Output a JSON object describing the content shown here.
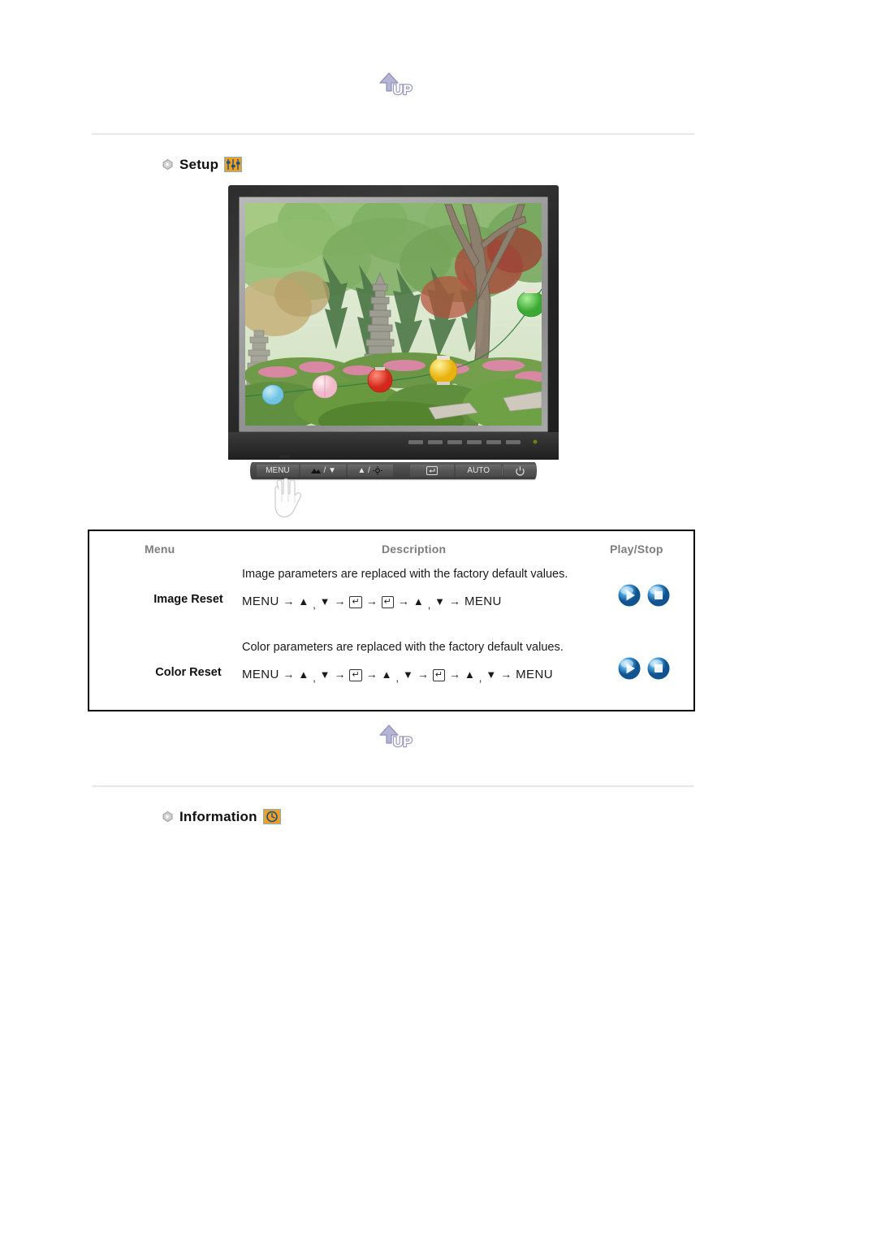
{
  "page": {
    "up_button_label": "UP",
    "up_button_icon": "up-arrow-icon"
  },
  "sections": [
    {
      "id": "setup",
      "title": "Setup",
      "bullet_icon": "diamond-bullet-icon",
      "badge_icon": "sliders-icon",
      "badge_color": "#f0a020"
    },
    {
      "id": "information",
      "title": "Information",
      "bullet_icon": "diamond-bullet-icon",
      "badge_icon": "clock-icon",
      "badge_color": "#f0a020"
    }
  ],
  "monitor": {
    "name": "lcd-monitor-illustration",
    "screen_image_alt": "garden with stone pagoda, trees and paper lanterns",
    "buttons": [
      {
        "id": "menu",
        "label": "MENU",
        "icon": ""
      },
      {
        "id": "down",
        "label": "/ ▼",
        "icon": "brightness-down-icon"
      },
      {
        "id": "up",
        "label": "▲ /",
        "icon": "brightness-up-icon"
      },
      {
        "id": "enter",
        "label": "",
        "icon": "enter-key-icon"
      },
      {
        "id": "auto",
        "label": "AUTO",
        "icon": ""
      },
      {
        "id": "power",
        "label": "⏻",
        "icon": "power-icon"
      }
    ]
  },
  "table": {
    "headers": {
      "menu": "Menu",
      "description": "Description",
      "play_stop": "Play/Stop"
    },
    "rows": [
      {
        "menu": "Image Reset",
        "description": "Image parameters are replaced with the factory default values.",
        "sequence_parts": [
          "MENU",
          "→",
          "▲",
          ",",
          "▼",
          "→",
          "⏎",
          "→",
          "⏎",
          "→",
          "▲",
          ",",
          "▼",
          "→",
          "MENU"
        ],
        "play_label": "play-button",
        "stop_label": "stop-button"
      },
      {
        "menu": "Color Reset",
        "description": "Color parameters are replaced with the factory default values.",
        "sequence_parts": [
          "MENU",
          "→",
          "▲",
          ",",
          "▼",
          "→",
          "⏎",
          "→",
          "▲",
          ",",
          "▼",
          "→",
          "⏎",
          "→",
          "▲",
          ",",
          "▼",
          "→",
          "MENU"
        ],
        "play_label": "play-button",
        "stop_label": "stop-button"
      }
    ]
  },
  "colors": {
    "badge_orange": "#f0a020",
    "badge_border_blue": "#7fb0cc",
    "header_gray": "#7d7d7d",
    "rule_gray": "#e8e8e8",
    "orb_blue": "#2f8fd4"
  }
}
